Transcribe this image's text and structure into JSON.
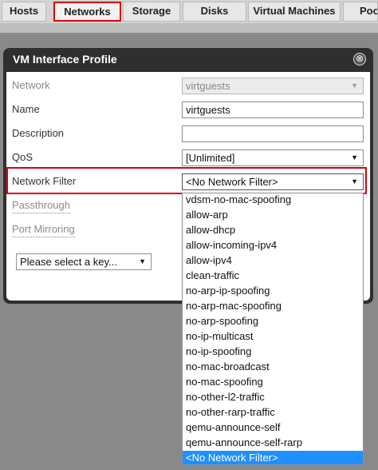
{
  "tabs": [
    {
      "label": "Hosts",
      "active": false
    },
    {
      "label": "Networks",
      "active": true
    },
    {
      "label": "Storage",
      "active": false
    },
    {
      "label": "Disks",
      "active": false
    },
    {
      "label": "Virtual Machines",
      "active": false
    },
    {
      "label": "Poo",
      "active": false
    }
  ],
  "dialog": {
    "title": "VM Interface Profile",
    "close_glyph": "⊗",
    "fields": {
      "network": {
        "label": "Network",
        "value": "virtguests"
      },
      "name": {
        "label": "Name",
        "value": "virtguests"
      },
      "description": {
        "label": "Description",
        "value": ""
      },
      "qos": {
        "label": "QoS",
        "value": "[Unlimited]"
      },
      "network_filter": {
        "label": "Network Filter",
        "value": "<No Network Filter>"
      },
      "passthrough": {
        "label": "Passthrough"
      },
      "port_mirroring": {
        "label": "Port Mirroring"
      }
    },
    "key_select": {
      "value": "Please select a key..."
    }
  },
  "dropdown": {
    "options": [
      "vdsm-no-mac-spoofing",
      "allow-arp",
      "allow-dhcp",
      "allow-incoming-ipv4",
      "allow-ipv4",
      "clean-traffic",
      "no-arp-ip-spoofing",
      "no-arp-mac-spoofing",
      "no-arp-spoofing",
      "no-ip-multicast",
      "no-ip-spoofing",
      "no-mac-broadcast",
      "no-mac-spoofing",
      "no-other-l2-traffic",
      "no-other-rarp-traffic",
      "qemu-announce-self",
      "qemu-announce-self-rarp",
      "<No Network Filter>"
    ],
    "selected": "<No Network Filter>"
  },
  "icons": {
    "dropdown_arrow": "▼"
  },
  "colors": {
    "highlight": "#d7000f",
    "selected_option": "#1e90ff",
    "dialog_header": "#2f2f2f"
  }
}
